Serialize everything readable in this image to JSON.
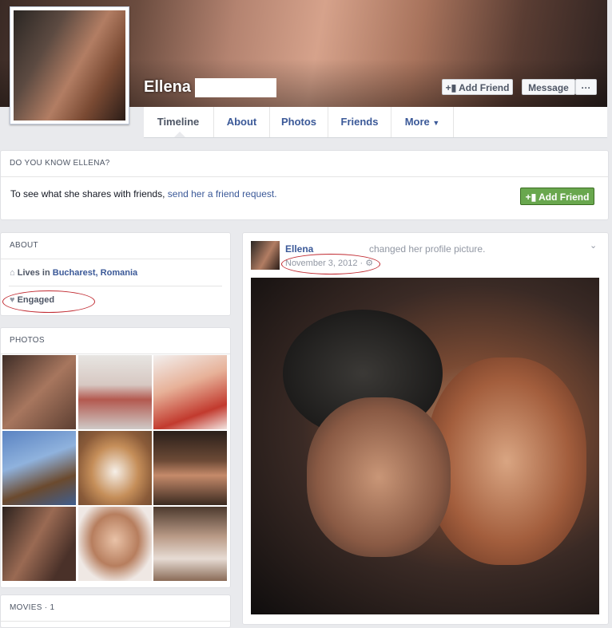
{
  "profile": {
    "name": "Ellena"
  },
  "header": {
    "add_friend_label": "Add Friend",
    "message_label": "Message",
    "more_label": "···"
  },
  "nav": {
    "tabs": [
      {
        "label": "Timeline"
      },
      {
        "label": "About"
      },
      {
        "label": "Photos"
      },
      {
        "label": "Friends"
      },
      {
        "label": "More"
      }
    ]
  },
  "know": {
    "title": "DO YOU KNOW ELLENA?",
    "text": "To see what she shares with friends,",
    "link": "send her a friend request.",
    "button": "Add Friend"
  },
  "about": {
    "title": "ABOUT",
    "lives_prefix": "Lives in",
    "lives_place": "Bucharest, Romania",
    "status": "Engaged"
  },
  "photos": {
    "title": "PHOTOS"
  },
  "movies": {
    "title": "MOVIES · 1"
  },
  "post": {
    "author": "Ellena",
    "action": "changed her profile picture.",
    "date": "November 3, 2012"
  },
  "colors": {
    "accent": "#3b5998",
    "green": "#69a74e",
    "highlight": "#c0282f"
  }
}
